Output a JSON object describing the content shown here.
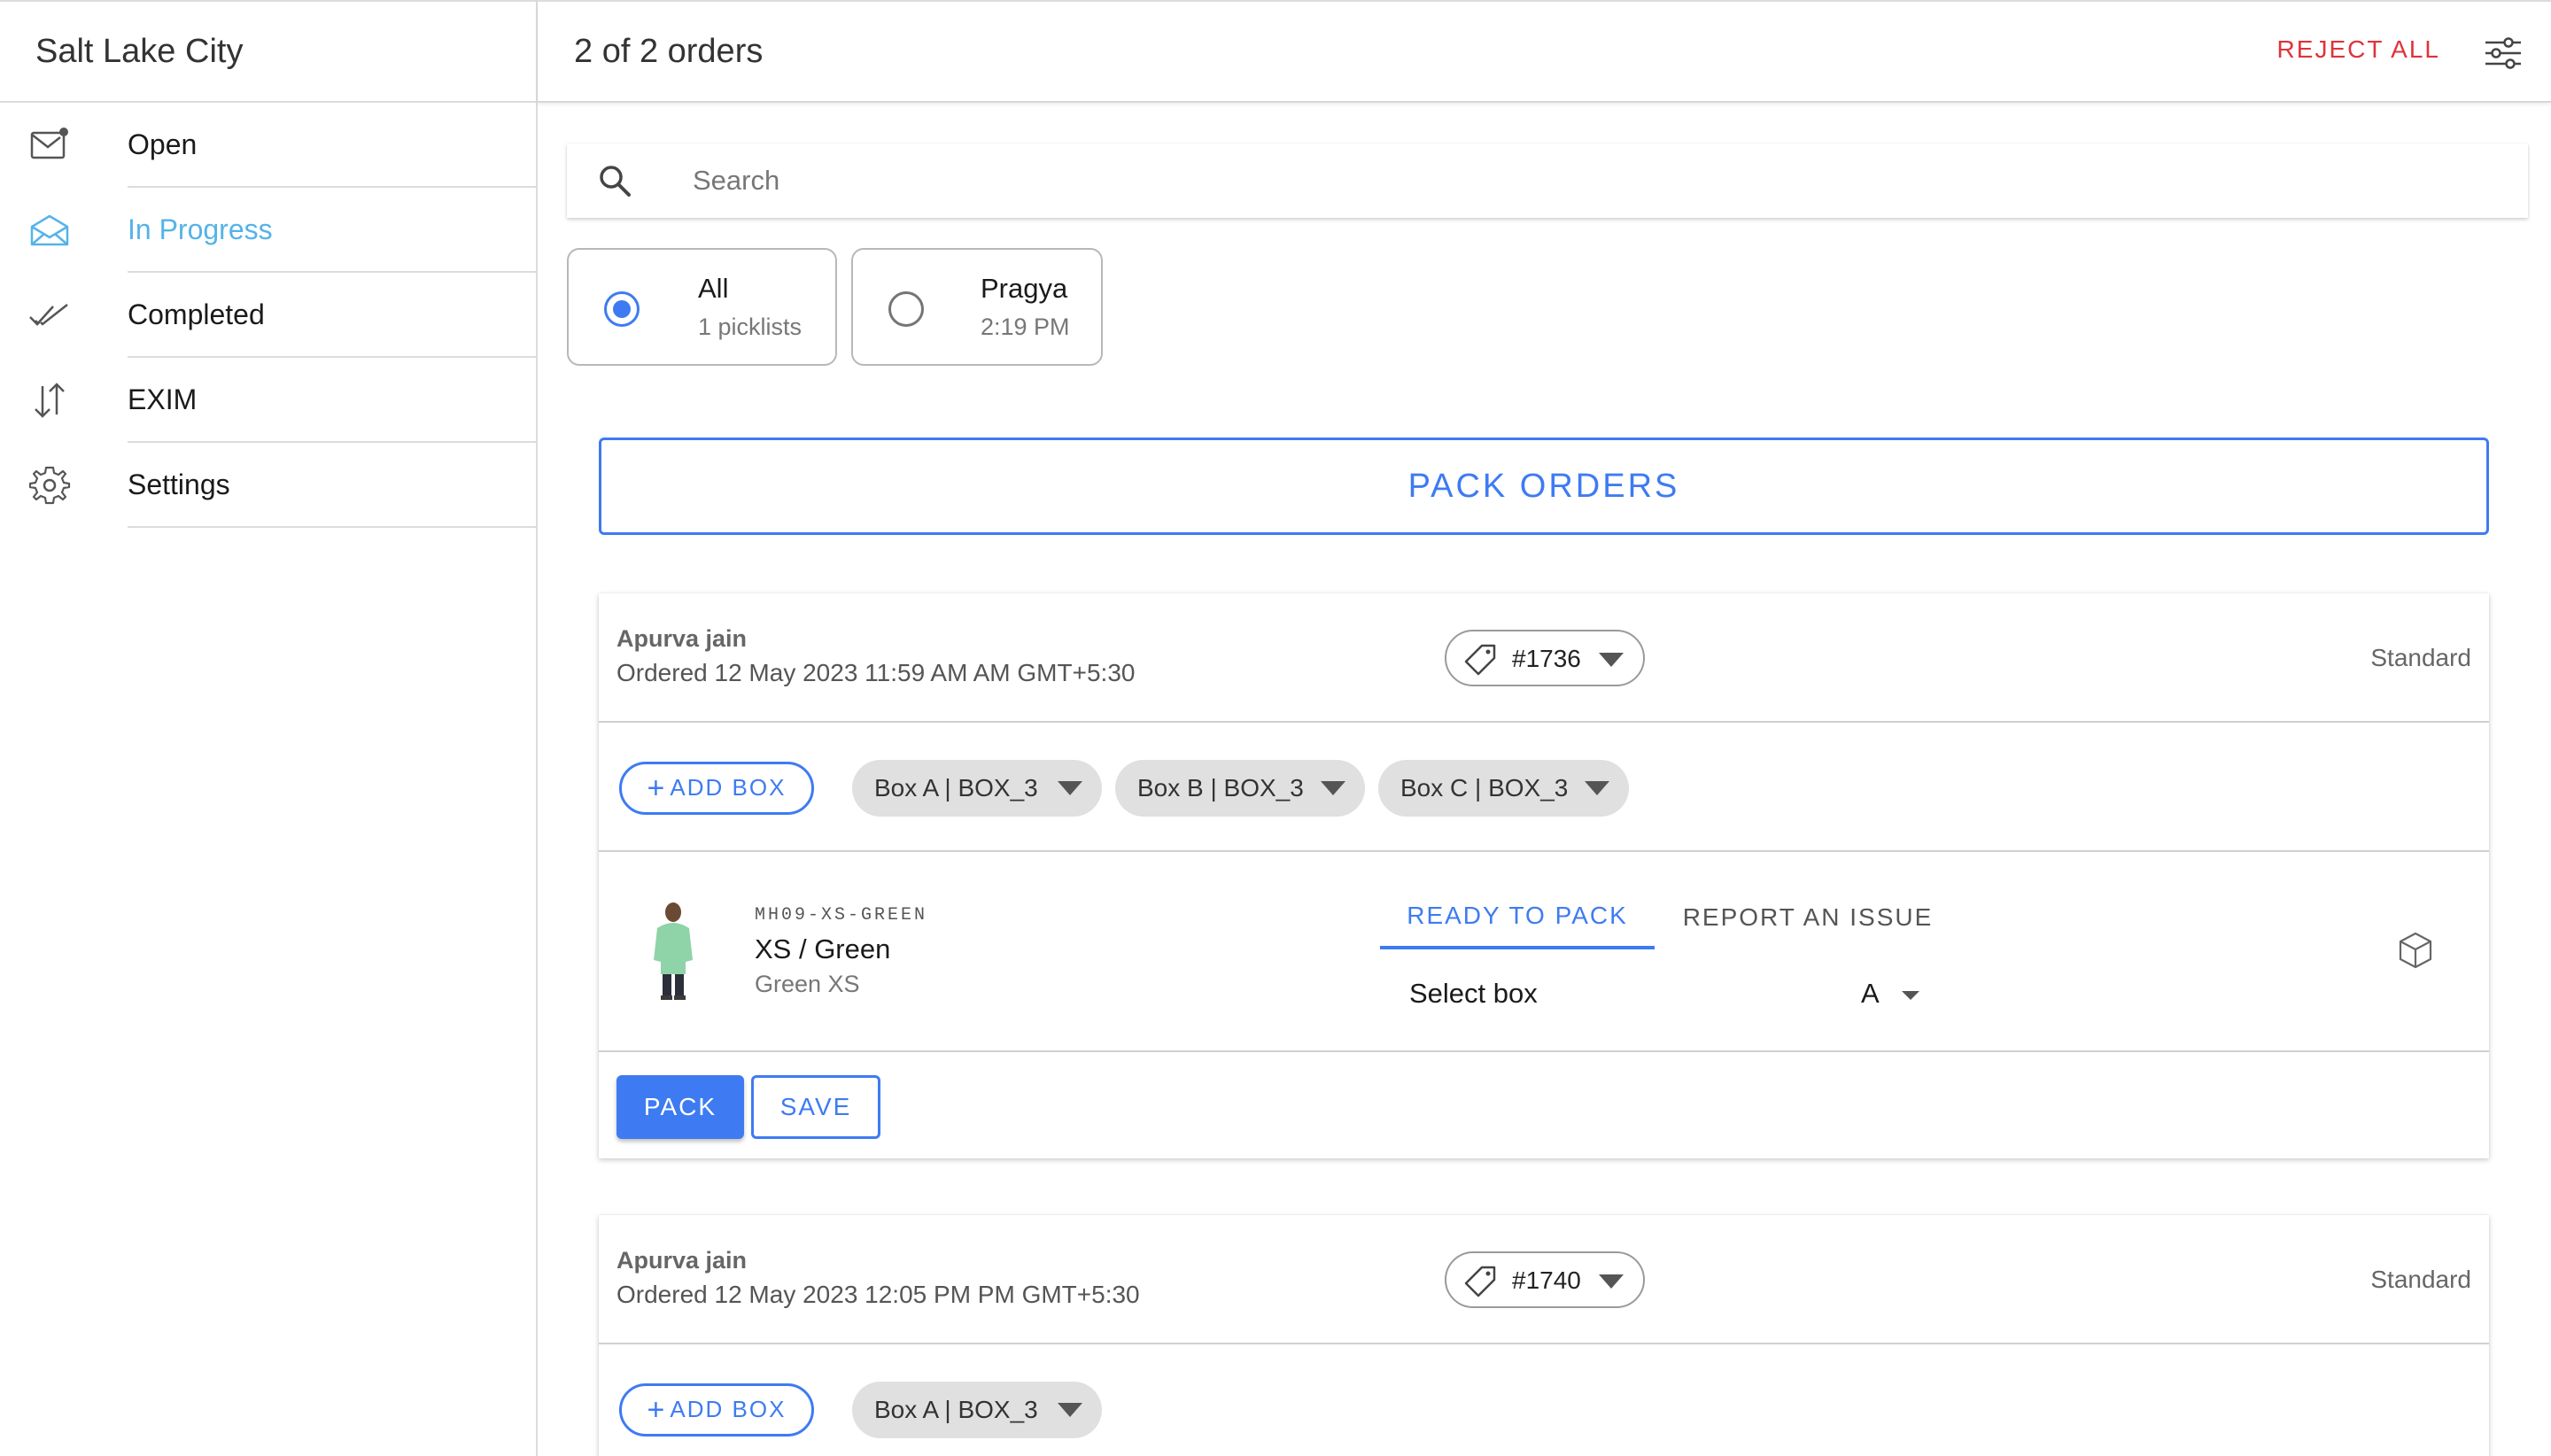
{
  "sidebar": {
    "title": "Salt Lake City",
    "items": [
      {
        "label": "Open",
        "icon": "mail-unread-icon"
      },
      {
        "label": "In Progress",
        "icon": "mail-open-icon",
        "active": true
      },
      {
        "label": "Completed",
        "icon": "done-all-icon"
      },
      {
        "label": "EXIM",
        "icon": "swap-vertical-icon"
      },
      {
        "label": "Settings",
        "icon": "settings-icon"
      }
    ]
  },
  "header": {
    "title": "2 of 2 orders",
    "reject_all": "REJECT ALL",
    "filter_icon": "options-icon"
  },
  "search": {
    "placeholder": "Search",
    "value": ""
  },
  "picklists": [
    {
      "title": "All",
      "subtitle": "1 picklists",
      "selected": true
    },
    {
      "title": "Pragya",
      "subtitle": "2:19 PM",
      "selected": false
    }
  ],
  "pack_orders_label": "PACK ORDERS",
  "orders": [
    {
      "customer": "Apurva jain",
      "date": "Ordered 12 May 2023 11:59 AM AM GMT+5:30",
      "order_id": "#1736",
      "shipping": "Standard",
      "add_box_label": "ADD BOX",
      "boxes": [
        "Box A | BOX_3",
        "Box B | BOX_3",
        "Box C | BOX_3"
      ],
      "item": {
        "sku": "MH09-XS-GREEN",
        "name": "XS / Green",
        "sub": "Green XS",
        "tab_ready": "READY TO PACK",
        "tab_issue": "REPORT AN ISSUE",
        "select_label": "Select box",
        "select_value": "A"
      },
      "pack_label": "PACK",
      "save_label": "SAVE"
    },
    {
      "customer": "Apurva jain",
      "date": "Ordered 12 May 2023 12:05 PM PM GMT+5:30",
      "order_id": "#1740",
      "shipping": "Standard",
      "add_box_label": "ADD BOX",
      "boxes": [
        "Box A | BOX_3"
      ]
    }
  ],
  "colors": {
    "accent": "#3e7bf2",
    "active_nav": "#55b3e8",
    "danger": "#e0323a",
    "chip_bg": "#e0e0e0"
  }
}
